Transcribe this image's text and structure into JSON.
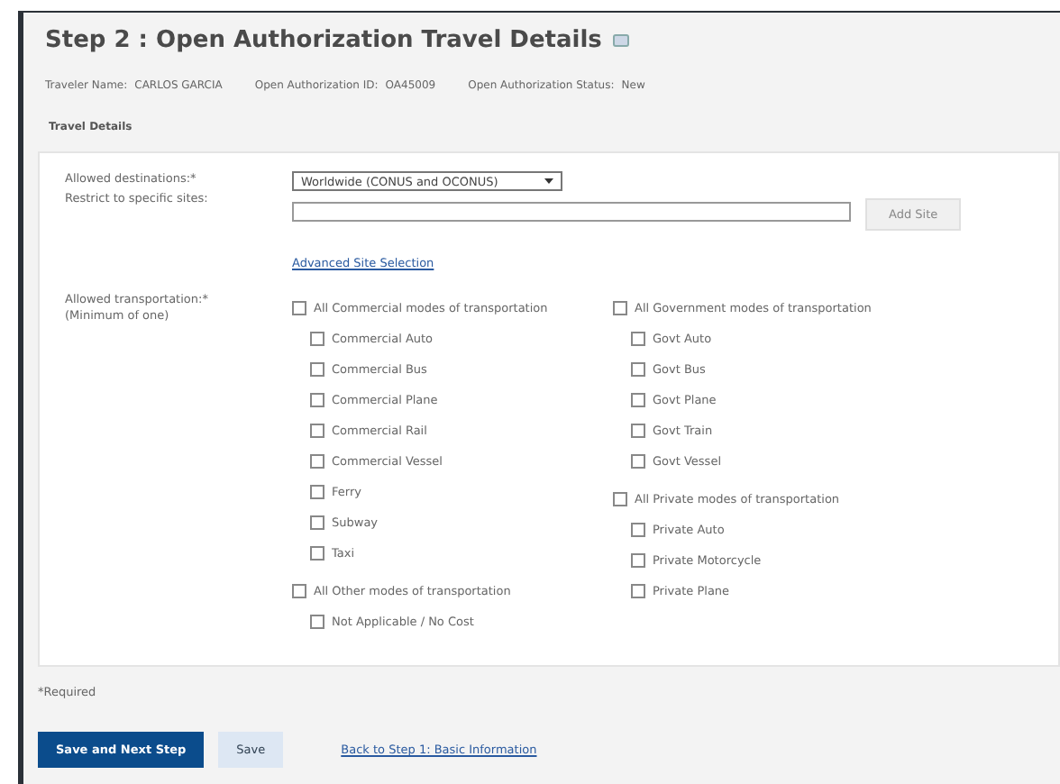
{
  "title": "Step 2 : Open Authorization Travel Details",
  "info": [
    {
      "label": "Traveler Name:",
      "value": "CARLOS GARCIA"
    },
    {
      "label": "Open Authorization ID:",
      "value": "OA45009"
    },
    {
      "label": "Open Authorization Status:",
      "value": "New"
    }
  ],
  "section": "Travel Details",
  "destinations": {
    "label": "Allowed destinations:*",
    "value": "Worldwide (CONUS and OCONUS)"
  },
  "restrict": {
    "label": "Restrict to specific sites:",
    "button": "Add Site",
    "link": "Advanced Site Selection"
  },
  "transportation": {
    "label": "Allowed transportation:*",
    "sublabel": "(Minimum of one)",
    "columns": [
      [
        {
          "label": "All Commercial modes of transportation",
          "checked": false,
          "children": [
            {
              "label": "Commercial Auto",
              "checked": false
            },
            {
              "label": "Commercial Bus",
              "checked": false
            },
            {
              "label": "Commercial Plane",
              "checked": false
            },
            {
              "label": "Commercial Rail",
              "checked": false
            },
            {
              "label": "Commercial Vessel",
              "checked": false
            },
            {
              "label": "Ferry",
              "checked": false
            },
            {
              "label": "Subway",
              "checked": false
            },
            {
              "label": "Taxi",
              "checked": false
            }
          ]
        },
        {
          "label": "All Other modes of transportation",
          "checked": false,
          "children": [
            {
              "label": "Not Applicable / No Cost",
              "checked": false
            }
          ]
        }
      ],
      [
        {
          "label": "All Government modes of transportation",
          "checked": false,
          "children": [
            {
              "label": "Govt Auto",
              "checked": false
            },
            {
              "label": "Govt Bus",
              "checked": false
            },
            {
              "label": "Govt Plane",
              "checked": false
            },
            {
              "label": "Govt Train",
              "checked": false
            },
            {
              "label": "Govt Vessel",
              "checked": false
            }
          ]
        },
        {
          "label": "All Private modes of transportation",
          "checked": false,
          "children": [
            {
              "label": "Private Auto",
              "checked": false
            },
            {
              "label": "Private Motorcycle",
              "checked": false
            },
            {
              "label": "Private Plane",
              "checked": false
            }
          ]
        }
      ]
    ]
  },
  "required_note": "*Required",
  "buttons": [
    {
      "label": "Save and Next Step",
      "kind": "primary"
    },
    {
      "label": "Save",
      "kind": "secondary"
    }
  ],
  "back_link": "Back to Step 1: Basic Information"
}
